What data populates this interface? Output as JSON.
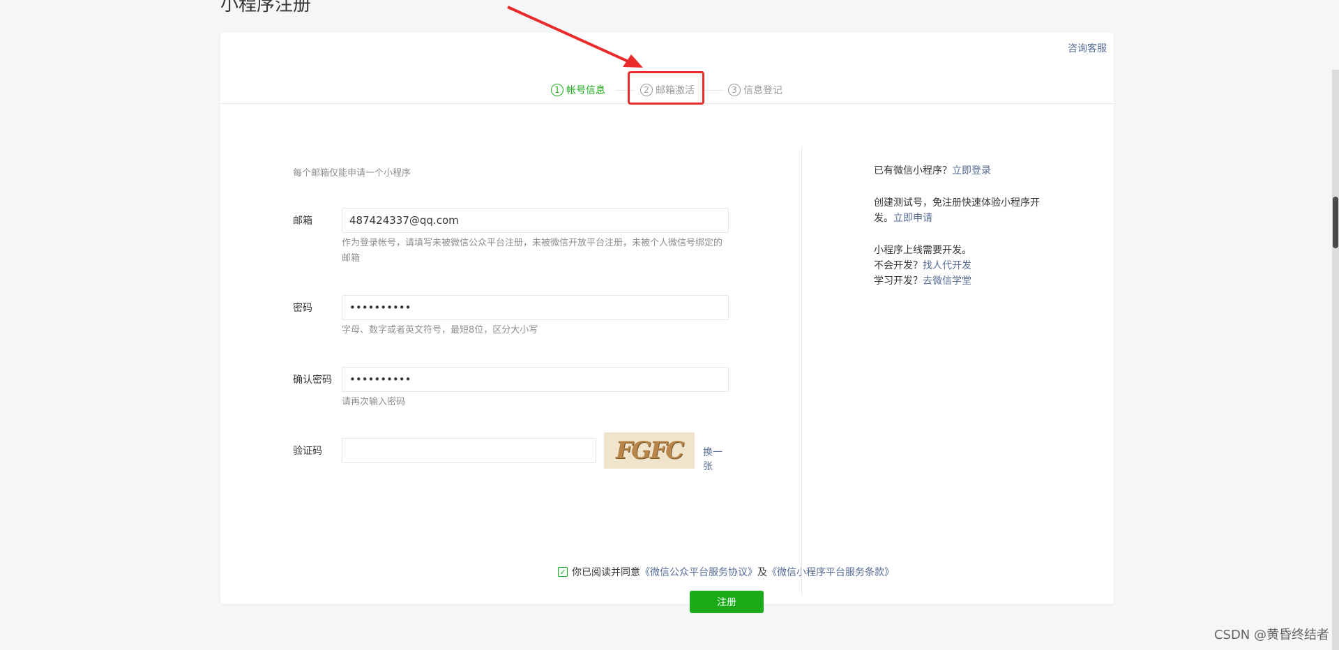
{
  "page": {
    "title": "小程序注册"
  },
  "header": {
    "help_link": "咨询客服"
  },
  "steps": [
    {
      "num": "1",
      "label": "帐号信息",
      "active": true
    },
    {
      "num": "2",
      "label": "邮箱激活",
      "active": false
    },
    {
      "num": "3",
      "label": "信息登记",
      "active": false
    }
  ],
  "form": {
    "tip": "每个邮箱仅能申请一个小程序",
    "email": {
      "label": "邮箱",
      "value": "487424337@qq.com",
      "hint": "作为登录帐号，请填写未被微信公众平台注册，未被微信开放平台注册，未被个人微信号绑定的邮箱"
    },
    "password": {
      "label": "密码",
      "value": "••••••••••",
      "hint": "字母、数字或者英文符号，最短8位，区分大小写"
    },
    "confirm_password": {
      "label": "确认密码",
      "value": "••••••••••",
      "hint": "请再次输入密码"
    },
    "captcha": {
      "label": "验证码",
      "value": "",
      "image_text": "FGFC",
      "refresh_label": "换一张"
    },
    "agree": {
      "prefix": "你已阅读并同意",
      "link1": "《微信公众平台服务协议》",
      "middle": "及",
      "link2": "《微信小程序平台服务条款》",
      "checked": true
    },
    "submit_label": "注册"
  },
  "sidebar": {
    "login_prefix": "已有微信小程序？",
    "login_link": "立即登录",
    "test_prefix": "创建测试号，免注册快速体验小程序开发。",
    "test_link": "立即申请",
    "dev_line1": "小程序上线需要开发。",
    "dev_line2_prefix": "不会开发？",
    "dev_line2_link": "找人代开发",
    "dev_line3_prefix": "学习开发？",
    "dev_line3_link": "去微信学堂"
  },
  "watermark": "CSDN @黄昏终结者",
  "colors": {
    "accent_green": "#1aad19",
    "link_blue": "#576b95",
    "highlight_red": "#ea2b2b"
  }
}
